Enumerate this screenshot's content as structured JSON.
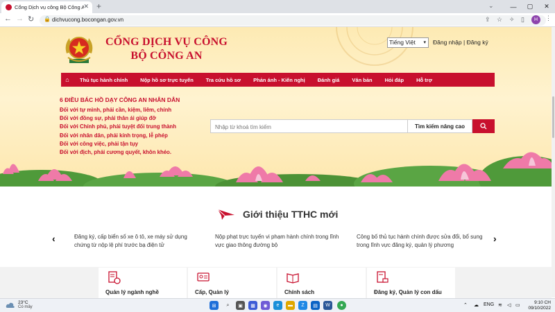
{
  "browser": {
    "tab_title": "Cổng Dịch vụ công Bộ Công An",
    "url": "dichvucong.bocongan.gov.vn",
    "profile_initial": "H"
  },
  "header": {
    "title_line1": "CỔNG DỊCH VỤ CÔNG",
    "title_line2": "BỘ CÔNG AN",
    "language": "Tiếng Việt",
    "login": "Đăng nhập",
    "separator": "|",
    "register": "Đăng ký"
  },
  "menu": {
    "items": [
      {
        "label": "Thủ tục hành chính"
      },
      {
        "label": "Nộp hồ sơ trực tuyến"
      },
      {
        "label": "Tra cứu hồ sơ"
      },
      {
        "label": "Phản ánh - Kiến nghị"
      },
      {
        "label": "Đánh giá"
      },
      {
        "label": "Văn bản"
      },
      {
        "label": "Hỏi đáp"
      },
      {
        "label": "Hỗ trợ"
      }
    ]
  },
  "advice": {
    "title": "6 ĐIỀU BÁC HỒ DẠY CÔNG AN NHÂN DÂN",
    "lines": [
      "Đối với tự mình, phải cần, kiệm, liêm, chính",
      "Đối với đồng sự, phải thân ái giúp đỡ",
      "Đối với Chính phủ, phải tuyệt đối trung thành",
      "Đối với nhân dân, phải kính trọng, lễ phép",
      "Đối với công việc, phải tận tụy",
      "Đối với địch, phải cương quyết, khôn khéo."
    ]
  },
  "search": {
    "placeholder": "Nhập từ khoá tìm kiếm",
    "advanced_label": "Tìm kiếm nâng cao"
  },
  "intro": {
    "title": "Giới thiệu TTHC mới",
    "items": [
      "Đăng ký, cấp biển số xe ô tô, xe máy sử dụng chứng từ nộp lệ phí trước bạ điện tử",
      "Nộp phạt trực tuyến vi phạm hành chính trong lĩnh vực giao thông đường bộ",
      "Công bố thủ tục hành chính được sửa đổi, bổ sung trong lĩnh vực đăng ký, quản lý phương"
    ]
  },
  "services": [
    {
      "label": "Quản lý ngành nghề"
    },
    {
      "label": "Cấp, Quản lý"
    },
    {
      "label": "Chính sách"
    },
    {
      "label": "Đăng ký, Quản lý con dấu"
    }
  ],
  "taskbar": {
    "temperature": "23°C",
    "condition": "Có mây",
    "language": "ENG",
    "time": "9:10 CH",
    "date": "09/10/2022"
  },
  "colors": {
    "brand_red": "#c8102e",
    "hero_bg": "#fdeab3"
  }
}
